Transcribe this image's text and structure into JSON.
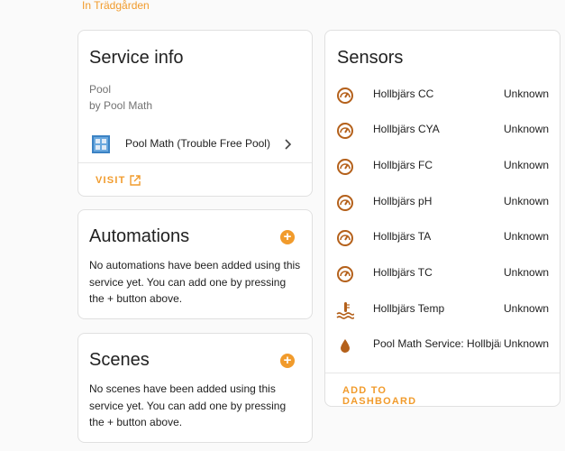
{
  "area_link": "In Trädgården",
  "service_info": {
    "title": "Service info",
    "model": "Pool",
    "manufacturer": "by Pool Math",
    "integration_name": "Pool Math (Trouble Free Pool)",
    "visit_label": "VISIT"
  },
  "automations": {
    "title": "Automations",
    "empty_text": "No automations have been added using this service yet. You can add one by pressing the + button above."
  },
  "scenes": {
    "title": "Scenes",
    "empty_text": "No scenes have been added using this service yet. You can add one by pressing the + button above."
  },
  "sensors": {
    "title": "Sensors",
    "items": [
      {
        "icon": "gauge-icon",
        "name": "Hollbjärs CC",
        "state": "Unknown"
      },
      {
        "icon": "gauge-icon",
        "name": "Hollbjärs CYA",
        "state": "Unknown"
      },
      {
        "icon": "gauge-icon",
        "name": "Hollbjärs FC",
        "state": "Unknown"
      },
      {
        "icon": "gauge-icon",
        "name": "Hollbjärs pH",
        "state": "Unknown"
      },
      {
        "icon": "gauge-icon",
        "name": "Hollbjärs TA",
        "state": "Unknown"
      },
      {
        "icon": "gauge-icon",
        "name": "Hollbjärs TC",
        "state": "Unknown"
      },
      {
        "icon": "water-thermometer-icon",
        "name": "Hollbjärs Temp",
        "state": "Unknown"
      },
      {
        "icon": "water-drop-icon",
        "name": "Pool Math Service: Hollbjärs",
        "state": "Unknown"
      }
    ],
    "add_label": "ADD TO DASHBOARD"
  },
  "colors": {
    "accent": "#f19b2c",
    "icon_brown": "#b4601a"
  }
}
